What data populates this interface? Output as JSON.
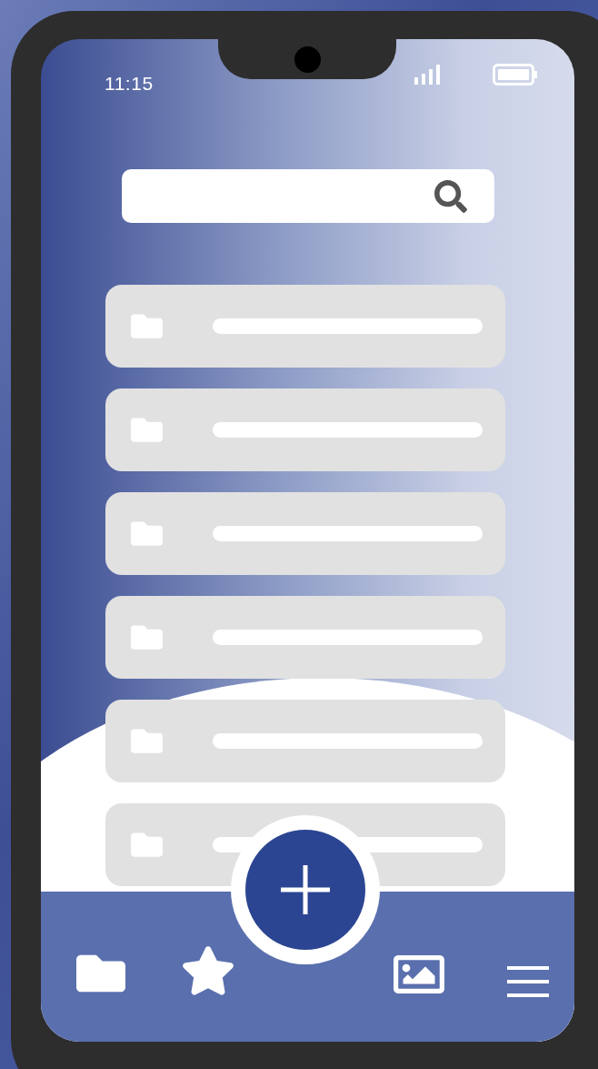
{
  "status_bar": {
    "time": "11:15"
  }
}
